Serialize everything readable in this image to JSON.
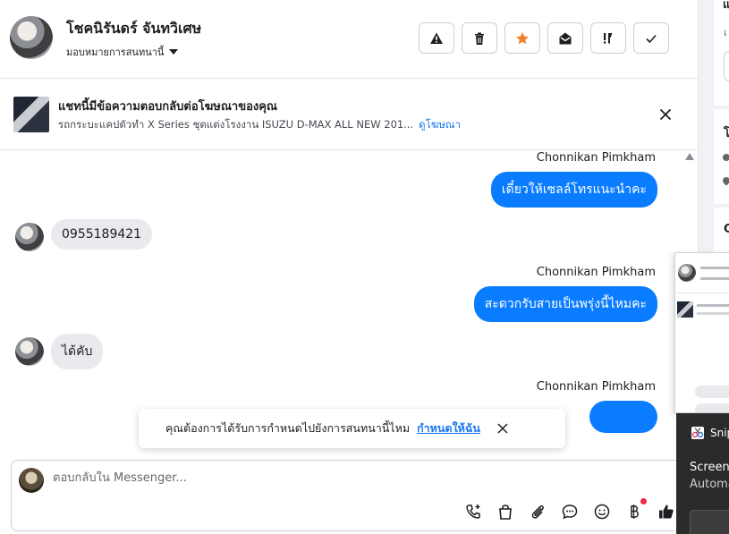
{
  "header": {
    "contact_name": "โชคนิรันดร์ จันทวิเศษ",
    "assign_label": "มอบหมายการสนทนานี้",
    "actions": [
      {
        "name": "spam",
        "icon": "warning-icon"
      },
      {
        "name": "delete",
        "icon": "trash-icon"
      },
      {
        "name": "star",
        "icon": "star-icon",
        "color": "#f0802a"
      },
      {
        "name": "mark-unread",
        "icon": "envelope-open-icon"
      },
      {
        "name": "follow-up",
        "icon": "follow-up-icon"
      },
      {
        "name": "done",
        "icon": "check-icon"
      }
    ]
  },
  "ad_banner": {
    "title": "แชทนี้มีข้อความตอบกลับต่อโฆษณาของคุณ",
    "subtitle": "รถกระบะแคปตัวทำ X Series ชุดแต่งโรงงาน ISUZU D-MAX ALL NEW 201...",
    "link": "ดูโฆษณา"
  },
  "messages": [
    {
      "direction": "out",
      "sender": "Chonnikan Pimkham",
      "text": "เดี๋ยวให้เซลล์โทรแนะนำคะ"
    },
    {
      "direction": "in",
      "text": "0955189421"
    },
    {
      "direction": "out",
      "sender": "Chonnikan Pimkham",
      "text": "สะดวกรับสายเป็นพรุ่งนี้ไหมคะ"
    },
    {
      "direction": "in",
      "text": "ได้คับ"
    },
    {
      "direction": "out",
      "sender": "Chonnikan Pimkham",
      "text": ""
    }
  ],
  "toast": {
    "text": "คุณต้องการได้รับการกำหนดไปยังการสนทนานี้ไหม",
    "link": "กำหนดให้ฉัน"
  },
  "composer": {
    "placeholder": "ตอบกลับใน Messenger...",
    "tools": [
      "call-icon",
      "bag-icon",
      "attach-icon",
      "chat-bubble-icon",
      "emoji-icon",
      "baht-icon",
      "thumbs-up-icon"
    ]
  },
  "sidebar": {
    "clipped_texts": [
      "แ",
      "เ",
      "โ",
      "C"
    ]
  },
  "snip_overlay": {
    "title": "Snip",
    "body_line1": "Screens",
    "body_line2": "Automa"
  },
  "colors": {
    "accent": "#0a7cff",
    "link": "#1877f2",
    "star": "#f0802a",
    "incoming_bubble": "#e9eaed"
  }
}
